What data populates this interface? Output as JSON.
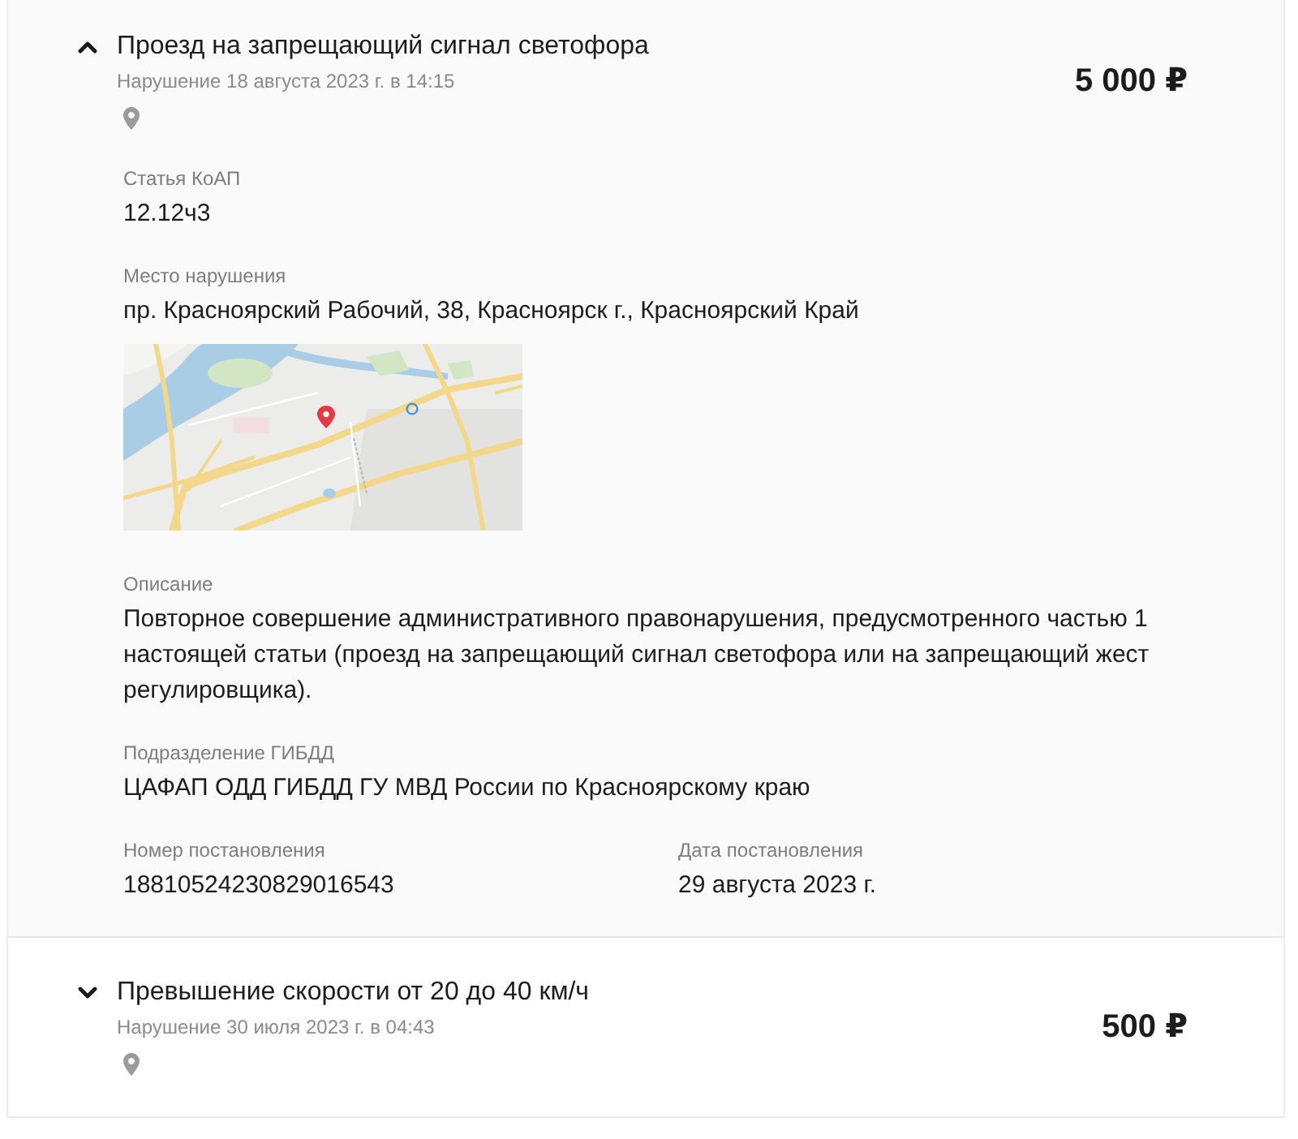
{
  "violations": [
    {
      "expanded": true,
      "title": "Проезд на запрещающий сигнал светофора",
      "date": "Нарушение 18 августа 2023 г. в 14:15",
      "amount": "5 000 ₽",
      "sections": [
        {
          "kind": "field",
          "label": "Статья КоАП",
          "value": "12.12ч3"
        },
        {
          "kind": "field",
          "label": "Место нарушения",
          "value": "пр. Красноярский Рабочий, 38, Красноярск г., Красноярский Край"
        },
        {
          "kind": "map"
        },
        {
          "kind": "field",
          "label": "Описание",
          "value": "Повторное совершение административного правонарушения, предусмотренного частью 1 настоящей статьи (проезд на запрещающий сигнал светофора или на запрещающий жест регулировщика)."
        },
        {
          "kind": "field",
          "label": "Подразделение ГИБДД",
          "value": "ЦАФАП ОДД ГИБДД ГУ МВД России по Красноярскому краю"
        },
        {
          "kind": "pair",
          "items": [
            {
              "label": "Номер постановления",
              "value": "18810524230829016543"
            },
            {
              "label": "Дата постановления",
              "value": "29 августа 2023 г."
            }
          ]
        }
      ]
    },
    {
      "expanded": false,
      "title": "Превышение скорости от 20 до 40 км/ч",
      "date": "Нарушение 30 июля 2023 г. в 04:43",
      "amount": "500 ₽"
    }
  ]
}
